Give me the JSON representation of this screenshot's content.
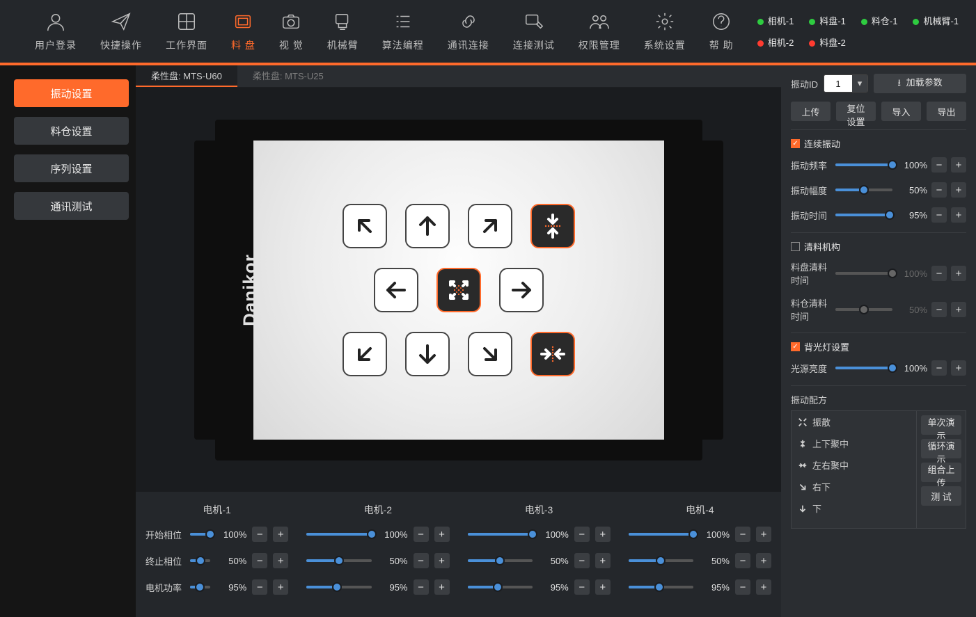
{
  "nav": {
    "items": [
      {
        "label": "用户登录",
        "icon": "user"
      },
      {
        "label": "快捷操作",
        "icon": "send"
      },
      {
        "label": "工作界面",
        "icon": "grid"
      },
      {
        "label": "料 盘",
        "icon": "tray",
        "active": true
      },
      {
        "label": "视 觉",
        "icon": "camera"
      },
      {
        "label": "机械臂",
        "icon": "arm"
      },
      {
        "label": "算法编程",
        "icon": "list"
      },
      {
        "label": "通讯连接",
        "icon": "link"
      },
      {
        "label": "连接测试",
        "icon": "test"
      },
      {
        "label": "权限管理",
        "icon": "users"
      },
      {
        "label": "系统设置",
        "icon": "gear"
      },
      {
        "label": "帮 助",
        "icon": "help"
      }
    ]
  },
  "status": [
    {
      "label": "相机-1",
      "color": "green"
    },
    {
      "label": "料盘-1",
      "color": "green"
    },
    {
      "label": "料仓-1",
      "color": "green"
    },
    {
      "label": "机械臂-1",
      "color": "green"
    },
    {
      "label": "相机-2",
      "color": "red"
    },
    {
      "label": "料盘-2",
      "color": "red"
    }
  ],
  "side_tabs": [
    {
      "label": "振动设置",
      "active": true
    },
    {
      "label": "料仓设置"
    },
    {
      "label": "序列设置"
    },
    {
      "label": "通讯测试"
    }
  ],
  "center_tabs": [
    {
      "label": "柔性盘: MTS-U60",
      "active": true
    },
    {
      "label": "柔性盘: MTS-U25"
    }
  ],
  "brand": "Danikor",
  "motors": {
    "row_labels": [
      "开始相位",
      "终止相位",
      "电机功率"
    ],
    "cols": [
      {
        "title": "电机-1",
        "vals": [
          "100%",
          "50%",
          "95%"
        ],
        "pos": [
          100,
          50,
          47
        ]
      },
      {
        "title": "电机-2",
        "vals": [
          "100%",
          "50%",
          "95%"
        ],
        "pos": [
          100,
          50,
          47
        ]
      },
      {
        "title": "电机-3",
        "vals": [
          "100%",
          "50%",
          "95%"
        ],
        "pos": [
          100,
          50,
          47
        ]
      },
      {
        "title": "电机-4",
        "vals": [
          "100%",
          "50%",
          "95%"
        ],
        "pos": [
          100,
          50,
          47
        ]
      }
    ]
  },
  "right": {
    "vib_id_label": "振动ID",
    "vib_id_value": "1",
    "load_params": "加载参数",
    "upload": "上传",
    "reset": "复位设置",
    "import": "导入",
    "export": "导出",
    "cont_vib": {
      "label": "连续振动",
      "checked": true
    },
    "sliders": [
      {
        "label": "振动频率",
        "val": "100%",
        "pos": 100,
        "enabled": true
      },
      {
        "label": "振动幅度",
        "val": "50%",
        "pos": 50,
        "enabled": true
      },
      {
        "label": "振动时间",
        "val": "95%",
        "pos": 95,
        "enabled": true
      }
    ],
    "clean": {
      "label": "清料机构",
      "checked": false,
      "sliders": [
        {
          "label": "料盘清料时间",
          "val": "100%",
          "pos": 100,
          "enabled": false
        },
        {
          "label": "料仓清料时间",
          "val": "50%",
          "pos": 50,
          "enabled": false
        }
      ]
    },
    "backlight": {
      "label": "背光灯设置",
      "checked": true,
      "slider": {
        "label": "光源亮度",
        "val": "100%",
        "pos": 100,
        "enabled": true
      }
    },
    "recipe_label": "振动配方",
    "recipes": [
      {
        "label": "振散",
        "icon": "scatter"
      },
      {
        "label": "上下聚中",
        "icon": "updown"
      },
      {
        "label": "左右聚中",
        "icon": "leftright"
      },
      {
        "label": "右下",
        "icon": "rd"
      },
      {
        "label": "下",
        "icon": "down"
      }
    ],
    "recipe_btns": [
      "单次演示",
      "循环演示",
      "组合上传",
      "测   试"
    ]
  }
}
